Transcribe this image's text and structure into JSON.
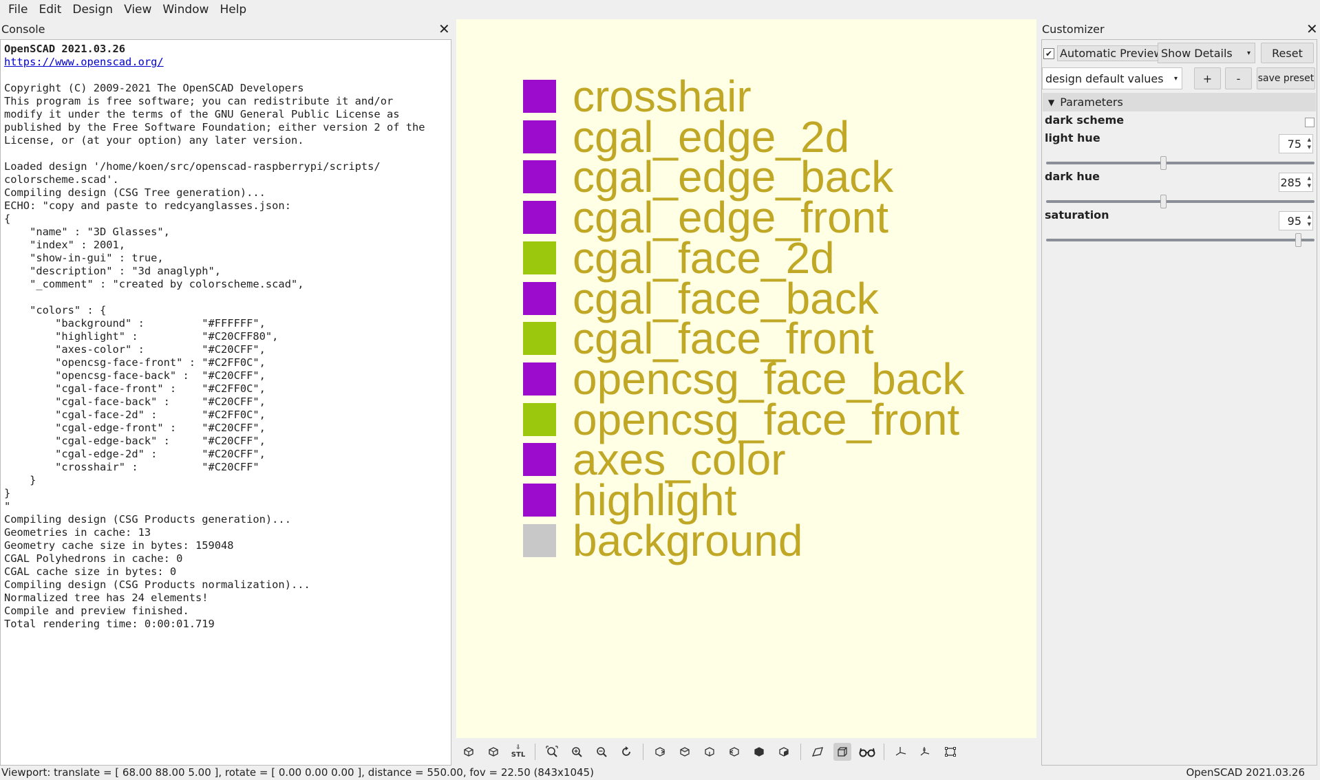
{
  "menu": [
    "File",
    "Edit",
    "Design",
    "View",
    "Window",
    "Help"
  ],
  "console": {
    "title": "Console",
    "heading": "OpenSCAD 2021.03.26",
    "url": "https://www.openscad.org/",
    "text": "\nCopyright (C) 2009-2021 The OpenSCAD Developers\nThis program is free software; you can redistribute it and/or\nmodify it under the terms of the GNU General Public License as\npublished by the Free Software Foundation; either version 2 of the\nLicense, or (at your option) any later version.\n\nLoaded design '/home/koen/src/openscad-raspberrypi/scripts/\ncolorscheme.scad'.\nCompiling design (CSG Tree generation)...\nECHO: \"copy and paste to redcyanglasses.json:\n{\n    \"name\" : \"3D Glasses\",\n    \"index\" : 2001,\n    \"show-in-gui\" : true,\n    \"description\" : \"3d anaglyph\",\n    \"_comment\" : \"created by colorscheme.scad\",\n\n    \"colors\" : {\n        \"background\" :         \"#FFFFFF\",\n        \"highlight\" :          \"#C20CFF80\",\n        \"axes-color\" :         \"#C20CFF\",\n        \"opencsg-face-front\" : \"#C2FF0C\",\n        \"opencsg-face-back\" :  \"#C20CFF\",\n        \"cgal-face-front\" :    \"#C2FF0C\",\n        \"cgal-face-back\" :     \"#C20CFF\",\n        \"cgal-face-2d\" :       \"#C2FF0C\",\n        \"cgal-edge-front\" :    \"#C20CFF\",\n        \"cgal-edge-back\" :     \"#C20CFF\",\n        \"cgal-edge-2d\" :       \"#C20CFF\",\n        \"crosshair\" :          \"#C20CFF\"\n    }\n}\n\"\nCompiling design (CSG Products generation)...\nGeometries in cache: 13\nGeometry cache size in bytes: 159048\nCGAL Polyhedrons in cache: 0\nCGAL cache size in bytes: 0\nCompiling design (CSG Products normalization)...\nNormalized tree has 24 elements!\nCompile and preview finished.\nTotal rendering time: 0:00:01.719"
  },
  "viewport": {
    "background": "#ffffe5",
    "legend": [
      {
        "label": "crosshair",
        "color": "#9b0ccc"
      },
      {
        "label": "cgal_edge_2d",
        "color": "#9b0ccc"
      },
      {
        "label": "cgal_edge_back",
        "color": "#9b0ccc"
      },
      {
        "label": "cgal_edge_front",
        "color": "#9b0ccc"
      },
      {
        "label": "cgal_face_2d",
        "color": "#9bc70c"
      },
      {
        "label": "cgal_face_back",
        "color": "#9b0ccc"
      },
      {
        "label": "cgal_face_front",
        "color": "#9bc70c"
      },
      {
        "label": "opencsg_face_back",
        "color": "#9b0ccc"
      },
      {
        "label": "opencsg_face_front",
        "color": "#9bc70c"
      },
      {
        "label": "axes_color",
        "color": "#9b0ccc"
      },
      {
        "label": "highlight",
        "color": "#9b0ccc"
      },
      {
        "label": "background",
        "color": "#c8c8c8"
      }
    ],
    "text_color": "#c0a826"
  },
  "toolbar": {
    "icons": [
      "preview-icon",
      "render-icon",
      "export-stl-icon",
      "view-all-icon",
      "zoom-in-icon",
      "zoom-out-icon",
      "reset-view-icon",
      "view-right-icon",
      "view-top-icon",
      "view-bottom-icon",
      "view-left-icon",
      "view-front-icon",
      "view-back-icon",
      "perspective-icon",
      "orthogonal-icon",
      "anaglyph-glasses-icon",
      "show-axes-icon",
      "show-scale-markers-icon",
      "show-edges-icon"
    ],
    "stl_label": "STL"
  },
  "statusbar": {
    "viewport_info": "Viewport: translate = [ 68.00 88.00 5.00 ], rotate = [ 0.00 0.00 0.00 ], distance = 550.00, fov = 22.50 (843x1045)",
    "version": "OpenSCAD 2021.03.26"
  },
  "customizer": {
    "title": "Customizer",
    "auto_preview_label": "Automatic Preview",
    "auto_preview_checked": true,
    "show_details": "Show Details",
    "reset_label": "Reset",
    "preset": "design default values",
    "add_label": "+",
    "remove_label": "-",
    "save_preset_label": "save preset",
    "section": "Parameters",
    "params": {
      "dark_scheme": {
        "label": "dark scheme",
        "checked": false
      },
      "light_hue": {
        "label": "light hue",
        "value": "75",
        "fraction": 0.435
      },
      "dark_hue": {
        "label": "dark hue",
        "value": "285",
        "fraction": 0.435
      },
      "saturation": {
        "label": "saturation",
        "value": "95",
        "fraction": 0.95
      }
    }
  }
}
